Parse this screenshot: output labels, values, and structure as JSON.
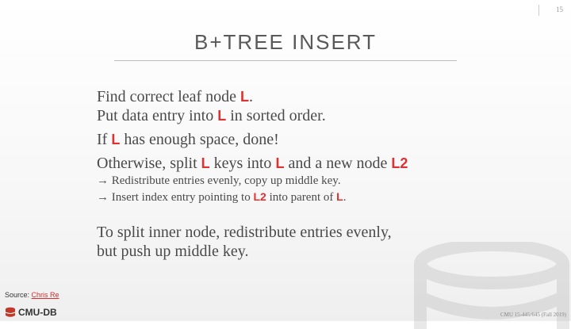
{
  "slide": {
    "page_number": "15",
    "title": "B+TREE INSERT",
    "lines": {
      "l1_a": "Find correct leaf node ",
      "l1_r": "L",
      "l1_b": ".",
      "l2_a": "Put data entry into ",
      "l2_r": "L",
      "l2_b": " in sorted order.",
      "l3_a": "If ",
      "l3_r": "L",
      "l3_b": " has enough space, done!",
      "l4_a": "Otherwise, split ",
      "l4_r1": "L",
      "l4_b": " keys into ",
      "l4_r2": "L",
      "l4_c": " and a new node ",
      "l4_r3": "L2",
      "s1": "→ Redistribute entries evenly, copy up middle key.",
      "s2_a": "→ Insert index entry pointing to ",
      "s2_r1": "L2",
      "s2_b": " into parent of ",
      "s2_r2": "L",
      "s2_c": ".",
      "l5": "To split inner node, redistribute entries evenly,",
      "l6": "but push up middle key."
    },
    "source_label": "Source: ",
    "source_link": "Chris Re",
    "logo_text": "CMU-DB",
    "footer": "CMU 15-445/645 (Fall 2019)",
    "colors": {
      "accent": "#e0302f",
      "text": "#4a4a4a",
      "title": "#595959"
    },
    "icons": {
      "logo": "database-icon",
      "watermark": "database-watermark-icon"
    }
  }
}
